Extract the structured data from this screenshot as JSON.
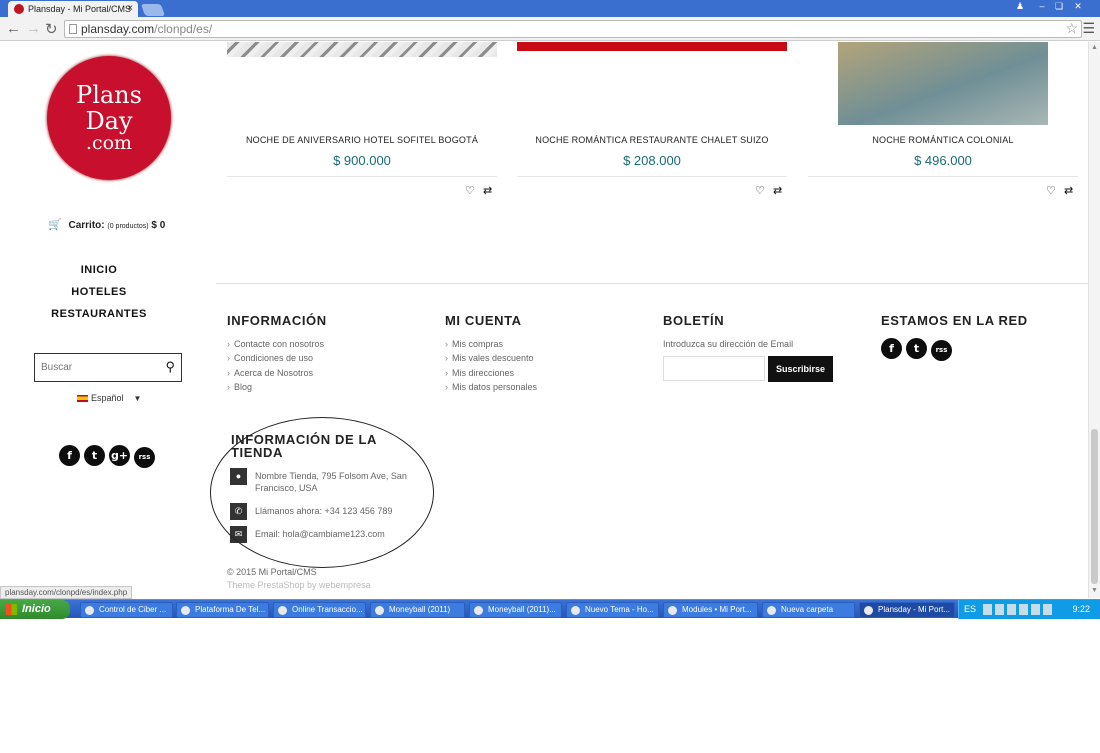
{
  "browser": {
    "tab_title": "Plansday - Mi Portal/CMS",
    "tab_close": "×",
    "url_host": "plansday.com",
    "url_path": "/clonpd/es/",
    "status_url": "plansday.com/clonpd/es/index.php"
  },
  "logo": {
    "line1": "Plans",
    "line2": "Day",
    "line3": ".com"
  },
  "cart": {
    "label": "Carrito:",
    "count": "(0 productos)",
    "total": "$ 0"
  },
  "nav": {
    "items": [
      "INICIO",
      "HOTELES",
      "RESTAURANTES"
    ]
  },
  "search": {
    "placeholder": "Buscar"
  },
  "language": {
    "current": "Español"
  },
  "sidebar_social": [
    "f",
    "t",
    "g+",
    "rss"
  ],
  "products": [
    {
      "name": "NOCHE DE ANIVERSARIO HOTEL SOFITEL BOGOTÁ",
      "price": "$ 900.000"
    },
    {
      "name": "NOCHE ROMÁNTICA RESTAURANTE CHALET SUIZO",
      "price": "$ 208.000"
    },
    {
      "name": "NOCHE ROMÁNTICA COLONIAL",
      "price": "$ 496.000"
    }
  ],
  "footer": {
    "info": {
      "title": "INFORMACIÓN",
      "links": [
        "Contacte con nosotros",
        "Condiciones de uso",
        "Acerca de Nosotros",
        "Blog"
      ]
    },
    "account": {
      "title": "MI CUENTA",
      "links": [
        "Mis compras",
        "Mis vales descuento",
        "Mis direcciones",
        "Mis datos personales"
      ]
    },
    "newsletter": {
      "title": "BOLETÍN",
      "hint": "Introduzca su dirección de Email",
      "button": "Suscribirse"
    },
    "network": {
      "title": "ESTAMOS EN LA RED"
    },
    "store": {
      "title": "INFORMACIÓN DE LA TIENDA",
      "address": "Nombre Tienda, 795 Folsom Ave, San Francisco, USA",
      "phone": "Llámanos ahora: +34 123 456 789",
      "email": "Email: hola@cambiame123.com"
    },
    "copyright": "© 2015 Mi Portal/CMS",
    "theme": "Theme PrestaShop by webempresa"
  },
  "taskbar": {
    "start": "Inicio",
    "tasks": [
      "Control de Ciber ...",
      "Plataforma De Tel...",
      "Online Transaccio...",
      "Moneyball (2011)",
      "Moneyball (2011)...",
      "Nuevo Tema - Ho...",
      "Modules • Mi Port...",
      "Nueva carpeta",
      "Plansday - Mi Port..."
    ],
    "lang": "ES",
    "clock": "9:22"
  }
}
